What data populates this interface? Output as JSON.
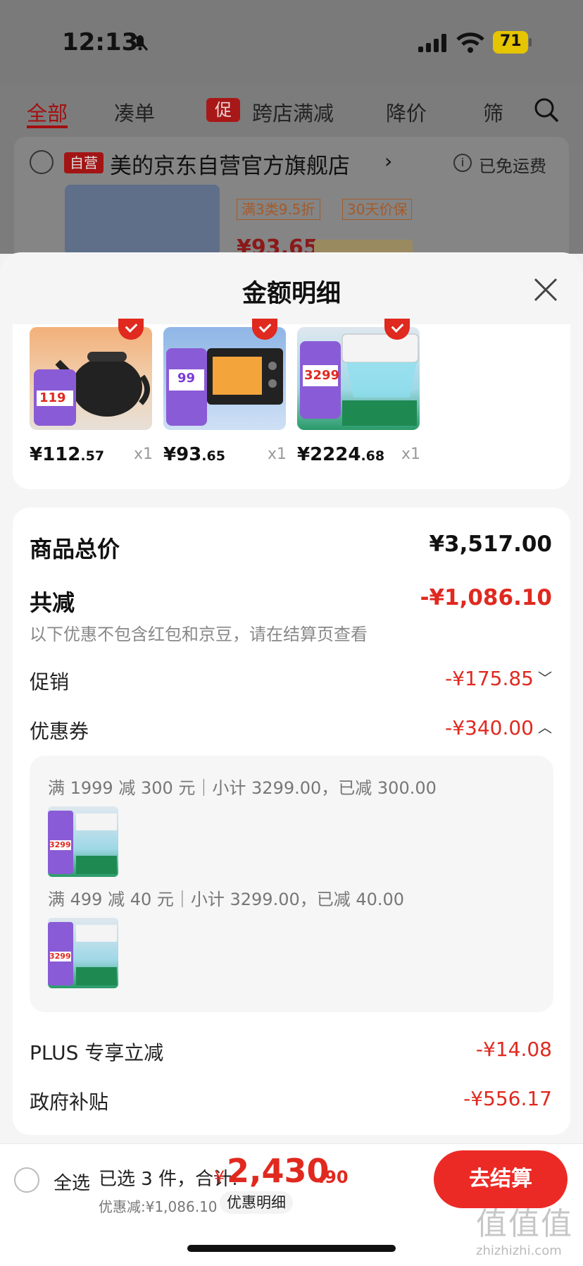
{
  "status_bar": {
    "time": "12:13",
    "battery": "71"
  },
  "background": {
    "tabs": [
      "全部",
      "凑单",
      "跨店满减",
      "降价",
      "筛"
    ],
    "promo_badge": "促",
    "store_badge": "自营",
    "store_name": "美的京东自营官方旗舰店",
    "store_arrow": "›",
    "free_shipping": "已免运费",
    "info_icon": "i",
    "tags": [
      "满3类9.5折",
      "30天价保"
    ],
    "price": "¥93.65"
  },
  "sheet": {
    "title": "金额明细",
    "products": [
      {
        "price_int": "¥112",
        "price_dec": ".57",
        "qty": "x1",
        "image_text": "119"
      },
      {
        "price_int": "¥93",
        "price_dec": ".65",
        "qty": "x1",
        "image_text": "99"
      },
      {
        "price_int": "¥2224",
        "price_dec": ".68",
        "qty": "x1",
        "image_text": "3299"
      }
    ],
    "summary": {
      "total_label": "商品总价",
      "total_value": "¥3,517.00",
      "reduce_label": "共减",
      "reduce_value": "-¥1,086.10",
      "note": "以下优惠不包含红包和京豆，请在结算页查看",
      "promo_label": "促销",
      "promo_value": "-¥175.85",
      "promo_chevron": "﹀",
      "coupon_label": "优惠券",
      "coupon_value": "-¥340.00",
      "coupon_chevron": "︿",
      "coupons": [
        {
          "text": "满 1999 减 300 元｜小计 3299.00，已减 300.00",
          "image_text": "3299"
        },
        {
          "text": "满 499 减 40 元｜小计 3299.00，已减 40.00",
          "image_text": "3299"
        }
      ],
      "plus_label": "PLUS 专享立减",
      "plus_value": "-¥14.08",
      "gov_label": "政府补贴",
      "gov_value": "-¥556.17"
    }
  },
  "bottom_bar": {
    "select_all": "全选",
    "selected_text": "已选 3 件，合计:",
    "pay_symbol": "¥",
    "pay_int": "2,430",
    "pay_dec": ".90",
    "discount_text": "优惠减:¥1,086.10",
    "detail_link": "优惠明细",
    "checkout": "去结算"
  },
  "watermark": {
    "main": "值值值",
    "sub": "zhizhizhi.com"
  },
  "colors": {
    "accent": "#e0291f",
    "checkout": "#ec2a25",
    "overlay": "#7a7a7a"
  }
}
